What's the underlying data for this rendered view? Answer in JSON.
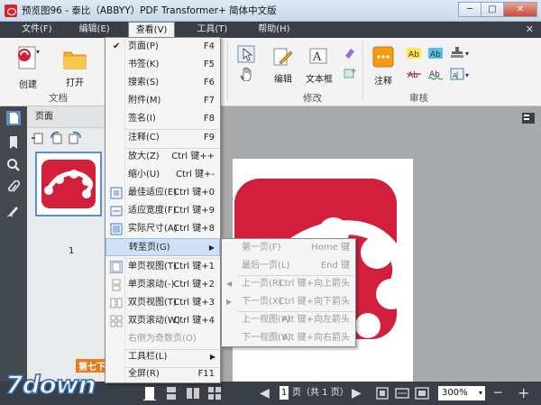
{
  "window": {
    "title": "预览图96 - 泰比（ABBYY）PDF Transformer+ 简体中文版",
    "minimize": "─",
    "maximize": "□",
    "close": "✕"
  },
  "menubar": {
    "items": [
      "文件(F)",
      "编辑(E)",
      "查看(V)",
      "工具(T)",
      "帮助(H)"
    ],
    "close": "✕"
  },
  "ribbon": {
    "create": "创建",
    "open": "打开",
    "group_doc": "文档",
    "edit": "编辑",
    "textbox": "文本框",
    "group_modify": "修改",
    "annotate": "注释",
    "group_review": "审核"
  },
  "pane": {
    "title": "页面",
    "page_number": "1"
  },
  "view_menu": {
    "items": [
      {
        "label": "页面(P)",
        "shortcut": "F4",
        "checked": true
      },
      {
        "label": "书签(K)",
        "shortcut": "F5"
      },
      {
        "label": "搜索(S)",
        "shortcut": "F6"
      },
      {
        "label": "附件(M)",
        "shortcut": "F7"
      },
      {
        "label": "签名(I)",
        "shortcut": "F8"
      },
      {
        "label": "注释(C)",
        "shortcut": "F9"
      },
      {
        "label": "放大(Z)",
        "shortcut": "Ctrl 键++"
      },
      {
        "label": "缩小(U)",
        "shortcut": "Ctrl 键+-"
      },
      {
        "label": "最佳适应(E)",
        "shortcut": "Ctrl 键+0"
      },
      {
        "label": "适应宽度(F)",
        "shortcut": "Ctrl 键+9"
      },
      {
        "label": "实际尺寸(A)",
        "shortcut": "Ctrl 键+8"
      },
      {
        "label": "转至页(G)",
        "shortcut": ""
      },
      {
        "label": "单页视图(T)",
        "shortcut": "Ctrl 键+1"
      },
      {
        "label": "单页滚动(-)",
        "shortcut": "Ctrl 键+2"
      },
      {
        "label": "双页视图(T)",
        "shortcut": "Ctrl 键+3"
      },
      {
        "label": "双页滚动(W)",
        "shortcut": "Ctrl 键+4"
      },
      {
        "label": "右侧为奇数页(O)",
        "shortcut": ""
      },
      {
        "label": "工具栏(L)",
        "shortcut": ""
      },
      {
        "label": "全屏(R)",
        "shortcut": "F11"
      }
    ]
  },
  "goto_submenu": {
    "items": [
      {
        "label": "第一页(F)",
        "shortcut": "Home 键"
      },
      {
        "label": "最后一页(L)",
        "shortcut": "End 键"
      },
      {
        "label": "上一页(R)",
        "shortcut": "Ctrl 键+向上箭头"
      },
      {
        "label": "下一页(X)",
        "shortcut": "Ctrl 键+向下箭头"
      },
      {
        "label": "上一视图(P)",
        "shortcut": "Alt 键+向左箭头"
      },
      {
        "label": "下一视图(V)",
        "shortcut": "Alt 键+向右箭头"
      }
    ]
  },
  "statusbar": {
    "page_input": "1",
    "page_label": "页（共 1 页）",
    "zoom": "300%",
    "zoom_out": "─",
    "zoom_in": "+"
  },
  "watermark": {
    "text": "7down",
    "sub": "第七下载"
  },
  "colors": {
    "brand_red": "#d21f3c",
    "menubar": "#3a3e47",
    "highlight": "#cfe1f7"
  }
}
